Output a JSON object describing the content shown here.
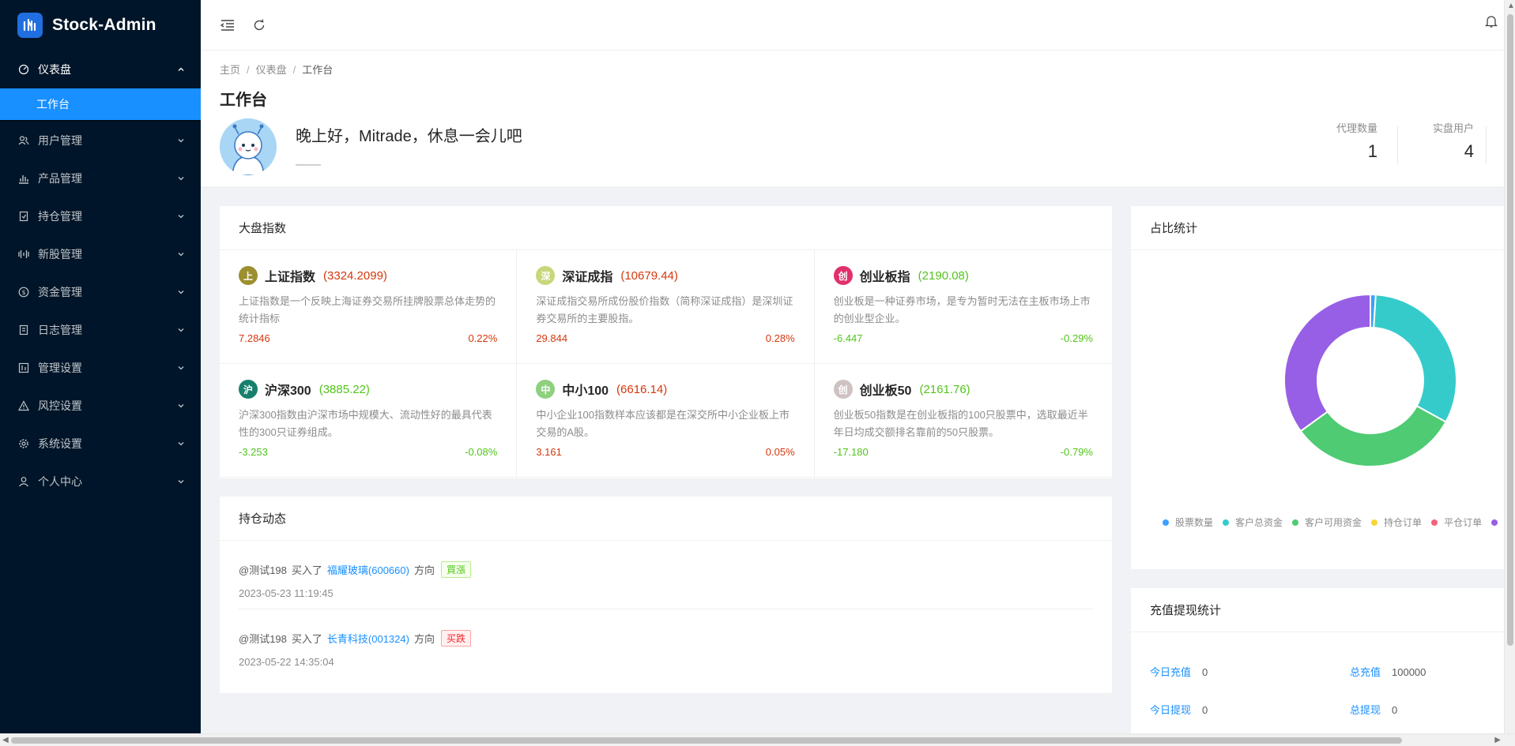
{
  "app": {
    "title": "Stock-Admin"
  },
  "sidebar": {
    "groups": [
      {
        "label": "仪表盘",
        "icon": "dashboard-icon",
        "open": true
      },
      {
        "label": "用户管理",
        "icon": "users-icon"
      },
      {
        "label": "产品管理",
        "icon": "bar-chart-icon"
      },
      {
        "label": "持仓管理",
        "icon": "position-icon"
      },
      {
        "label": "新股管理",
        "icon": "ipo-icon"
      },
      {
        "label": "资金管理",
        "icon": "money-icon"
      },
      {
        "label": "日志管理",
        "icon": "log-icon"
      },
      {
        "label": "管理设置",
        "icon": "settings-panel-icon"
      },
      {
        "label": "风控设置",
        "icon": "warning-icon"
      },
      {
        "label": "系统设置",
        "icon": "gear-icon"
      },
      {
        "label": "个人中心",
        "icon": "user-icon"
      }
    ],
    "dashboard_sub": {
      "label": "工作台"
    }
  },
  "breadcrumb": {
    "home": "主页",
    "parent": "仪表盘",
    "current": "工作台",
    "sep": "/"
  },
  "page": {
    "title": "工作台",
    "greeting": "晚上好，Mitrade，休息一会儿吧",
    "subline": "——"
  },
  "stats": [
    {
      "label": "代理数量",
      "value": "1"
    },
    {
      "label": "实盘用户",
      "value": "4"
    }
  ],
  "market": {
    "title": "大盘指数",
    "items": [
      {
        "badge": "上",
        "badge_color": "#9c8f2e",
        "name": "上证指数",
        "value": "(3324.2099)",
        "trend": "up",
        "desc": "上证指数是一个反映上海证券交易所挂牌股票总体走势的统计指标",
        "change": "7.2846",
        "pct": "0.22%"
      },
      {
        "badge": "深",
        "badge_color": "#c9d67a",
        "name": "深证成指",
        "value": "(10679.44)",
        "trend": "up",
        "desc": "深证成指交易所成份股价指数（简称深证成指）是深圳证券交易所的主要股指。",
        "change": "29.844",
        "pct": "0.28%"
      },
      {
        "badge": "创",
        "badge_color": "#e0306d",
        "name": "创业板指",
        "value": "(2190.08)",
        "trend": "down",
        "desc": "创业板是一种证券市场，是专为暂时无法在主板市场上市的创业型企业。",
        "change": "-6.447",
        "pct": "-0.29%"
      },
      {
        "badge": "沪",
        "badge_color": "#177f6d",
        "name": "沪深300",
        "value": "(3885.22)",
        "trend": "down",
        "desc": "沪深300指数由沪深市场中规模大、流动性好的最具代表性的300只证券组成。",
        "change": "-3.253",
        "pct": "-0.08%"
      },
      {
        "badge": "中",
        "badge_color": "#8fd07f",
        "name": "中小100",
        "value": "(6616.14)",
        "trend": "up",
        "desc": "中小企业100指数样本应该都是在深交所中小企业板上市交易的A股。",
        "change": "3.161",
        "pct": "0.05%"
      },
      {
        "badge": "创",
        "badge_color": "#cfc2c2",
        "name": "创业板50",
        "value": "(2161.76)",
        "trend": "down",
        "desc": "创业板50指数是在创业板指的100只股票中，选取最近半年日均成交额排名靠前的50只股票。",
        "change": "-17.180",
        "pct": "-0.79%"
      }
    ]
  },
  "positions": {
    "title": "持仓动态",
    "items": [
      {
        "user": "@测试198",
        "action": "买入了",
        "stock": "福耀玻璃(600660)",
        "dir_label": "方向",
        "tag": "買漲",
        "tag_type": "up",
        "time": "2023-05-23 11:19:45"
      },
      {
        "user": "@测试198",
        "action": "买入了",
        "stock": "长青科技(001324)",
        "dir_label": "方向",
        "tag": "买跌",
        "tag_type": "down",
        "time": "2023-05-22 14:35:04"
      }
    ]
  },
  "ratio": {
    "title": "占比统计",
    "legend": [
      {
        "name": "股票数量",
        "color": "#3ba1ff"
      },
      {
        "name": "客户总资金",
        "color": "#36cbcb"
      },
      {
        "name": "客户可用资金",
        "color": "#4ecb73"
      },
      {
        "name": "持仓订单",
        "color": "#fbd437"
      },
      {
        "name": "平仓订单",
        "color": "#f2637b"
      },
      {
        "name": "",
        "color": "#975fe5"
      }
    ]
  },
  "chart_data": {
    "type": "pie",
    "donut": true,
    "categories": [
      "股票数量",
      "客户总资金",
      "客户可用资金",
      "持仓订单",
      "平仓订单",
      ""
    ],
    "values": [
      1,
      32,
      32,
      0,
      0,
      35
    ],
    "colors": [
      "#3ba1ff",
      "#36cbcb",
      "#4ecb73",
      "#fbd437",
      "#f2637b",
      "#975fe5"
    ],
    "legend": "bottom"
  },
  "recharge": {
    "title": "充值提现统计",
    "today_recharge_label": "今日充值",
    "today_recharge": "0",
    "total_recharge_label": "总充值",
    "total_recharge": "100000",
    "today_withdraw_label": "今日提现",
    "today_withdraw": "0",
    "total_withdraw_label": "总提现",
    "total_withdraw": "0"
  }
}
